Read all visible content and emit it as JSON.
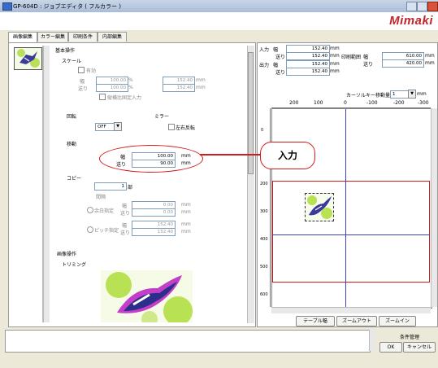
{
  "window": {
    "title": "GP-604D : ジョブエディタ ( フルカラー )",
    "logo": "Mimaki"
  },
  "tabs": [
    {
      "label": "画像編集"
    },
    {
      "label": "カラー編集"
    },
    {
      "label": "印刷条件"
    },
    {
      "label": "内部編集"
    }
  ],
  "left": {
    "basic_header": "基本操作",
    "scale": {
      "label": "スケール",
      "enable_label": "有効",
      "width_label": "幅",
      "feed_label": "送り",
      "width_pct": "100.00",
      "feed_pct": "100.00",
      "pct_unit": "%",
      "width_mm": "152.40",
      "feed_mm": "152.40",
      "mm_unit": "mm",
      "keep_ratio_label": "縦横比固定入力"
    },
    "rotation": {
      "label": "回転",
      "value": "OFF"
    },
    "mirror": {
      "label": "ミラー",
      "lr_label": "左右反転"
    },
    "move": {
      "label": "移動",
      "width_label": "幅",
      "feed_label": "送り",
      "width_value": "100.00",
      "feed_value": "90.00",
      "unit": "mm"
    },
    "copy": {
      "label": "コピー",
      "count": "1",
      "count_unit": "部",
      "interval_label": "間隔",
      "margin_label": "余白指定",
      "pitch_label": "ピッチ指定",
      "width_label": "幅",
      "feed_label": "送り",
      "margin_width": "0.00",
      "margin_feed": "0.00",
      "pitch_width": "152.40",
      "pitch_feed": "152.40",
      "unit": "mm"
    },
    "image_header": "画像操作",
    "trimming_label": "トリミング"
  },
  "info": {
    "input_label": "入力",
    "output_label": "出力",
    "width_label": "幅",
    "feed_label": "送り",
    "input_width": "152.40",
    "input_feed": "152.40",
    "output_width": "152.40",
    "output_feed": "152.40",
    "unit": "mm",
    "printable_label": "印刷範囲",
    "printable_width": "610.00",
    "printable_feed": "420.00",
    "cursor_label": "カーソルキー移動量",
    "cursor_value": "1",
    "cursor_unit": "mm"
  },
  "ruler": {
    "top": [
      "200",
      "100",
      "0",
      "-100",
      "-200",
      "-300"
    ],
    "left": [
      "0",
      "100",
      "200",
      "300",
      "400",
      "500",
      "600"
    ]
  },
  "view_buttons": {
    "table_width": "テーブル幅",
    "zoom_out": "ズームアウト",
    "zoom_in": "ズームイン"
  },
  "bottom": {
    "condition": "条件管理",
    "ok": "OK",
    "cancel": "キャンセル"
  },
  "callout": {
    "text": "入力"
  }
}
